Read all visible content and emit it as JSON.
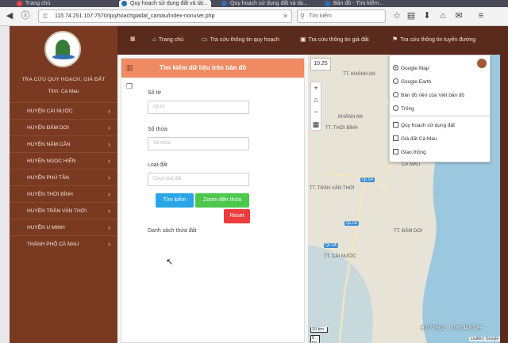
{
  "browser": {
    "tabs": [
      {
        "label": "Trang chủ"
      },
      {
        "label": "Quy hoạch sử dụng đất và tài..."
      },
      {
        "label": "Quy hoạch sử dụng đất và tài..."
      },
      {
        "label": "Bản đồ - Tìm kiếm..."
      }
    ],
    "url": "115.74.251.107:7570/quyhoachgiadat_camau/index-nonuser.php",
    "search_placeholder": "Tìm kiếm"
  },
  "site": {
    "title": "TRA CỨU QUY HOẠCH, GIÁ ĐẤT",
    "subtitle": "Tỉnh: Cà Mau"
  },
  "topnav": [
    {
      "label": "Trang chủ"
    },
    {
      "label": "Tra cứu thông tin quy hoạch"
    },
    {
      "label": "Tra cứu thông tin giá đất"
    },
    {
      "label": "Tra cứu thông tin tuyến đường"
    }
  ],
  "sidebar": {
    "items": [
      {
        "label": "HUYỆN CÁI NƯỚC"
      },
      {
        "label": "HUYỆN ĐẦM DƠI"
      },
      {
        "label": "HUYỆN NĂM CĂN"
      },
      {
        "label": "HUYỆN NGỌC HIỂN"
      },
      {
        "label": "HUYỆN PHÚ TÂN"
      },
      {
        "label": "HUYỆN THỚI BÌNH"
      },
      {
        "label": "HUYỆN TRẦN VĂN THỜI"
      },
      {
        "label": "HUYỆN U MINH"
      },
      {
        "label": "THÀNH PHỐ CÀ MAU"
      }
    ]
  },
  "panel": {
    "title": "Tìm kiếm dữ liệu trên bản đồ",
    "fields": [
      {
        "label": "Số tờ",
        "placeholder": "Số tờ"
      },
      {
        "label": "Số thửa",
        "placeholder": "Số thửa"
      },
      {
        "label": "Loại đất",
        "placeholder": "Chọn loại đất"
      }
    ],
    "search_label": "Tìm kiếm",
    "zoom_label": "Zoom đến thửa",
    "reset_label": "Reset",
    "list_title": "Danh sách thửa đất"
  },
  "map": {
    "zoom": "10.25",
    "basemaps": [
      {
        "label": "Google Map",
        "selected": true
      },
      {
        "label": "Google Earth",
        "selected": false
      },
      {
        "label": "Bản đồ nền của Việt bản đồ",
        "selected": false
      },
      {
        "label": "Trống",
        "selected": false
      }
    ],
    "overlays": [
      {
        "label": "Quy hoạch sử dụng đất"
      },
      {
        "label": "Giá đất Cà Mau"
      },
      {
        "label": "Giao thông"
      }
    ],
    "labels": {
      "tt_khanh_an": "TT. KHÁNH AN",
      "khanh_an": "KHÁNH AN",
      "tt_thoi_binh": "TT. THỚI BÌNH",
      "tt_tran_van_thoi": "TT. TRẦN VĂN THỜI",
      "tt_dam_doi": "TT. ĐẦM DƠI",
      "tt_cai_nuoc": "TT. CÁI NƯỚC",
      "ca_mau": "CÀ MAU",
      "ql1a_1": "QL1A",
      "ql1a_2": "QL1A",
      "ql1a_3": "QL1A"
    },
    "coords": "9.077802 : 105.045129",
    "scale_top": "10 km",
    "scale_bottom": "5 mi",
    "attribution": "Leaflet | Google"
  },
  "colors": {
    "header": "#5a2a1c",
    "sidebar": "#7a3a22",
    "panel_head": "#ef8a62",
    "btn_search": "#2aa6e8",
    "btn_zoom": "#4cc84c",
    "btn_reset": "#ef3b3b",
    "sea": "#9cc8df"
  }
}
